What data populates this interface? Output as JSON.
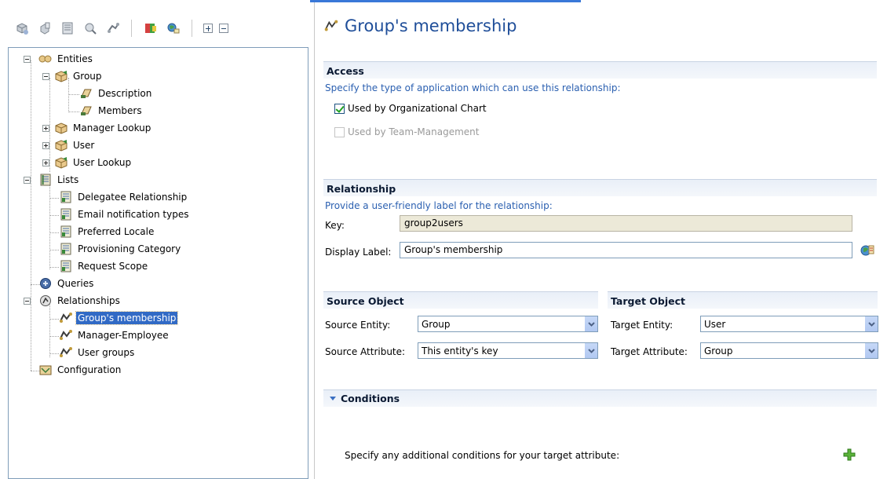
{
  "toolbar": {
    "icons": [
      "new-entity-icon",
      "new-attribute-icon",
      "new-list-icon",
      "new-query-icon",
      "new-relationship-icon",
      "configure-icon",
      "localize-icon",
      "expand-all-icon",
      "collapse-all-icon"
    ]
  },
  "tree": {
    "entities": "Entities",
    "group": "Group",
    "description": "Description",
    "members": "Members",
    "manager_lookup": "Manager Lookup",
    "user": "User",
    "user_lookup": "User Lookup",
    "lists": "Lists",
    "delegatee": "Delegatee Relationship",
    "email_types": "Email notification types",
    "preferred_locale": "Preferred Locale",
    "provisioning": "Provisioning Category",
    "request_scope": "Request Scope",
    "queries": "Queries",
    "relationships": "Relationships",
    "groups_membership": "Group's membership",
    "manager_employee": "Manager-Employee",
    "user_groups": "User groups",
    "configuration": "Configuration"
  },
  "editor": {
    "title": "Group's membership",
    "access": {
      "title": "Access",
      "desc": "Specify the type of application which can use this relationship:",
      "org_chart": "Used by Organizational Chart",
      "org_chart_checked": true,
      "team_mgmt": "Used by Team-Management",
      "team_mgmt_checked": false
    },
    "relationship": {
      "title": "Relationship",
      "desc": "Provide a user-friendly label for the relationship:",
      "key_label": "Key:",
      "key_value": "group2users",
      "display_label": "Display Label:",
      "display_value": "Group's membership"
    },
    "source": {
      "title": "Source Object",
      "entity_label": "Source Entity:",
      "entity_value": "Group",
      "attr_label": "Source Attribute:",
      "attr_value": "This entity's key"
    },
    "target": {
      "title": "Target Object",
      "entity_label": "Target Entity:",
      "entity_value": "User",
      "attr_label": "Target Attribute:",
      "attr_value": "Group"
    },
    "conditions": {
      "title": "Conditions",
      "desc": "Specify any additional conditions for your target attribute:"
    }
  },
  "colors": {
    "accent": "#316ac5",
    "title": "#1f4e99",
    "desc": "#2a5fb0"
  }
}
